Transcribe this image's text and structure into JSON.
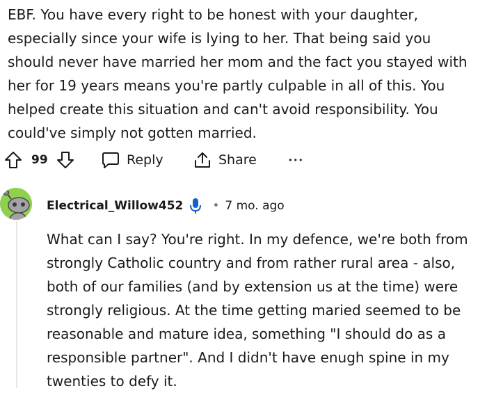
{
  "parent_comment": {
    "body": "EBF. You have every right to be honest with your daughter,\nespecially since your wife is lying to her. That being said you\nshould never have married her mom and the fact you stayed with\nher for 19 years means you're partly culpable in all of this. You\nhelped create this situation and can't avoid responsibility. You\ncould've simply not gotten married.",
    "vote_count": "99",
    "reply_label": "Reply",
    "share_label": "Share",
    "more_label": "•••"
  },
  "reply_comment": {
    "username": "Electrical_Willow452",
    "separator": "•",
    "timestamp": "7 mo. ago",
    "body": "What can I say? You're right. In my defence, we're both from\nstrongly Catholic country and from rather rural area - also,\nboth of our families (and by extension us at the time) were\nstrongly religious. At the time getting maried seemed to be\nreasonable and mature idea, something \"I should do as a\nresponsible partner\". And I didn't have enugh spine in my\ntwenties to defy it."
  },
  "colors": {
    "text": "#1a1a1b",
    "avatar_bg": "#8fd14f",
    "mic_icon": "#1a5fc8",
    "thread_line": "#e6e6e6"
  }
}
